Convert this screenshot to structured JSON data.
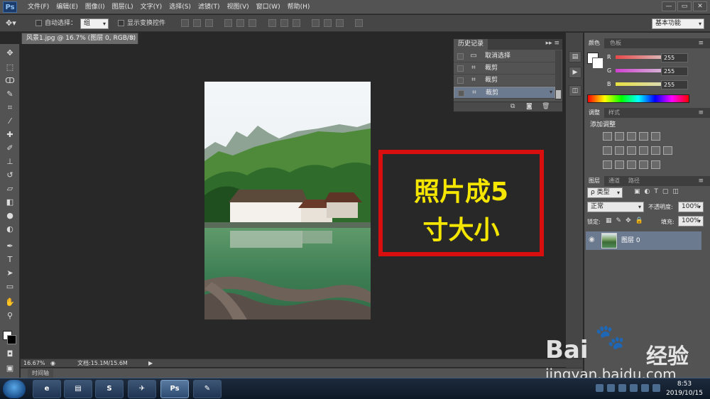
{
  "app": {
    "logo": "Ps",
    "menus": [
      "文件(F)",
      "编辑(E)",
      "图像(I)",
      "图层(L)",
      "文字(Y)",
      "选择(S)",
      "滤镜(T)",
      "视图(V)",
      "窗口(W)",
      "帮助(H)"
    ],
    "window_buttons": [
      "—",
      "▭",
      "✕"
    ]
  },
  "options": {
    "auto_select_label": "自动选择：",
    "auto_select_value": "组",
    "show_transform_label": "显示变换控件",
    "workspace": "基本功能"
  },
  "document": {
    "tab_title": "风景1.jpg @ 16.7% (图层 0, RGB/8) *",
    "close": "×",
    "zoom": "16.67%",
    "doc_info": "文档:15.1M/15.6M",
    "timeline_tab": "时间轴"
  },
  "callout": {
    "line1": "照片成5",
    "line2": "寸大小"
  },
  "history": {
    "tab": "历史记录",
    "items": [
      {
        "label": "取消选择",
        "icon": "folder-icon"
      },
      {
        "label": "裁剪",
        "icon": "crop-icon"
      },
      {
        "label": "裁剪",
        "icon": "crop-icon"
      },
      {
        "label": "裁剪",
        "icon": "crop-icon"
      }
    ]
  },
  "color_panel": {
    "tabs": [
      "颜色",
      "色板"
    ],
    "r_label": "R",
    "g_label": "G",
    "b_label": "B",
    "r": "255",
    "g": "255",
    "b": "255",
    "r_color": "#e84848",
    "g_color": "#d040d0",
    "b_color": "#e8e040"
  },
  "adjust_panel": {
    "tabs": [
      "调整",
      "样式"
    ],
    "title": "添加调整"
  },
  "layers_panel": {
    "tabs": [
      "图层",
      "通道",
      "路径"
    ],
    "kind_label": "ρ 类型",
    "blend_mode": "正常",
    "opacity_label": "不透明度:",
    "opacity": "100%",
    "lock_label": "锁定:",
    "fill_label": "填充:",
    "fill": "100%",
    "layer_name": "图层 0"
  },
  "watermark": {
    "brand": "Bai",
    "brand_suffix": "经验",
    "url": "jingyan.baidu.com"
  },
  "taskbar": {
    "time": "8:53",
    "date": "2019/10/15",
    "ps_label": "Ps"
  }
}
